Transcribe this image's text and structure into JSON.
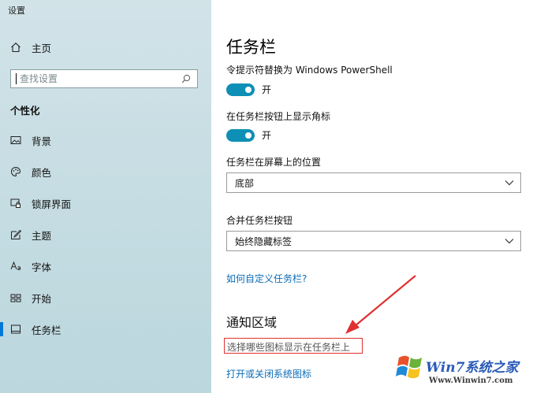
{
  "app": {
    "title": "设置"
  },
  "sidebar": {
    "home_label": "主页",
    "search_placeholder": "查找设置",
    "section_label": "个性化",
    "items": [
      {
        "label": "背景",
        "icon": "picture-icon"
      },
      {
        "label": "颜色",
        "icon": "palette-icon"
      },
      {
        "label": "锁屏界面",
        "icon": "lockscreen-icon"
      },
      {
        "label": "主题",
        "icon": "theme-icon"
      },
      {
        "label": "字体",
        "icon": "font-icon"
      },
      {
        "label": "开始",
        "icon": "start-icon"
      },
      {
        "label": "任务栏",
        "icon": "taskbar-icon",
        "active": true
      }
    ]
  },
  "main": {
    "title": "任务栏",
    "powershell_label": "令提示符替换为 Windows PowerShell",
    "powershell_state": "开",
    "badges_label": "在任务栏按钮上显示角标",
    "badges_state": "开",
    "location_label": "任务栏在屏幕上的位置",
    "location_value": "底部",
    "combine_label": "合并任务栏按钮",
    "combine_value": "始终隐藏标签",
    "customize_link": "如何自定义任务栏?",
    "notification_title": "通知区域",
    "select_icons_link": "选择哪些图标显示在任务栏上",
    "system_icons_link": "打开或关闭系统图标"
  },
  "watermark": {
    "brand": "Win7系统之家",
    "url": "Www.Winwin7.com"
  },
  "colors": {
    "accent": "#0078d7",
    "toggle_on": "#0e8fb5",
    "link": "#0a6cb8",
    "annotation": "#e03030"
  }
}
